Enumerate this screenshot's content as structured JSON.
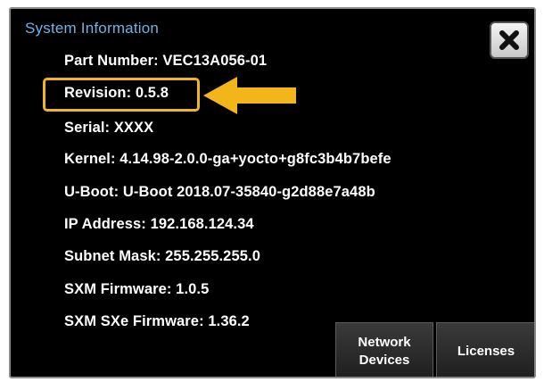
{
  "dialog": {
    "title": "System Information",
    "close_icon": "close-x-icon"
  },
  "info": {
    "part_number": "Part Number: VEC13A056-01",
    "revision": "Revision: 0.5.8",
    "serial": "Serial: XXXX",
    "kernel": "Kernel: 4.14.98-2.0.0-ga+yocto+g8fc3b4b7befe",
    "uboot": "U-Boot: U-Boot 2018.07-35840-g2d88e7a48b",
    "ip_address": "IP Address: 192.168.124.34",
    "subnet_mask": "Subnet Mask: 255.255.255.0",
    "sxm_firmware": "SXM Firmware: 1.0.5",
    "sxm_sxe_firmware": "SXM SXe Firmware: 1.36.2"
  },
  "buttons": {
    "network_line1": "Network",
    "network_line2": "Devices",
    "licenses": "Licenses"
  },
  "annotation": {
    "highlight_color": "#f2b61b",
    "arrow_icon": "arrow-left-icon"
  },
  "colors": {
    "title": "#6fb2e8",
    "background": "#000000",
    "text": "#ffffff"
  }
}
